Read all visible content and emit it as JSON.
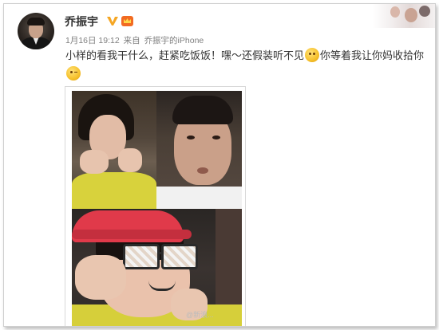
{
  "post": {
    "author_name": "乔振宇",
    "timestamp": "1月16日 19:12",
    "source_prefix": "来自",
    "source": "乔振宇的iPhone",
    "text_part1": "小样的看我干什么，赶紧吃饭饭！嘿～还假装听不见",
    "text_part2": "你等着我让你妈收拾你",
    "emojis": [
      "awkward-smile-emoji",
      "wink-emoji"
    ],
    "watermark": "@新浪..."
  },
  "icons": {
    "verified_badge": "verified-v-icon",
    "member_badge": "vip-crown-icon"
  },
  "colors": {
    "verified": "#f5a623",
    "vip": "#f26b22",
    "text": "#333333",
    "meta": "#808080"
  }
}
